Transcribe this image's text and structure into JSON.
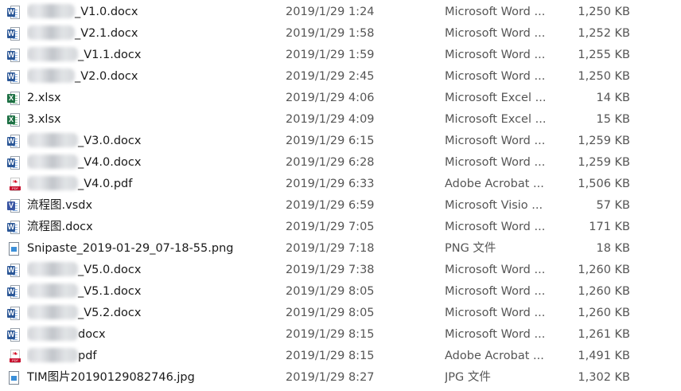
{
  "files": [
    {
      "name": "_V1.0.docx",
      "blur_width": 60,
      "date": "2019/1/29 1:24",
      "type": "Microsoft Word ...",
      "size": "1,250 KB",
      "icon": "word-icon"
    },
    {
      "name": "_V2.1.docx",
      "blur_width": 60,
      "date": "2019/1/29 1:58",
      "type": "Microsoft Word ...",
      "size": "1,252 KB",
      "icon": "word-icon"
    },
    {
      "name": "_V1.1.docx",
      "blur_width": 64,
      "date": "2019/1/29 1:59",
      "type": "Microsoft Word ...",
      "size": "1,255 KB",
      "icon": "word-icon"
    },
    {
      "name": "_V2.0.docx",
      "blur_width": 60,
      "date": "2019/1/29 2:45",
      "type": "Microsoft Word ...",
      "size": "1,250 KB",
      "icon": "word-icon"
    },
    {
      "name": "2.xlsx",
      "blur_width": 0,
      "date": "2019/1/29 4:06",
      "type": "Microsoft Excel ...",
      "size": "14 KB",
      "icon": "excel-icon"
    },
    {
      "name": "3.xlsx",
      "blur_width": 0,
      "date": "2019/1/29 4:09",
      "type": "Microsoft Excel ...",
      "size": "15 KB",
      "icon": "excel-icon"
    },
    {
      "name": "_V3.0.docx",
      "blur_width": 64,
      "date": "2019/1/29 6:15",
      "type": "Microsoft Word ...",
      "size": "1,259 KB",
      "icon": "word-icon"
    },
    {
      "name": "_V4.0.docx",
      "blur_width": 64,
      "date": "2019/1/29 6:28",
      "type": "Microsoft Word ...",
      "size": "1,259 KB",
      "icon": "word-icon"
    },
    {
      "name": "_V4.0.pdf",
      "blur_width": 64,
      "date": "2019/1/29 6:33",
      "type": "Adobe Acrobat ...",
      "size": "1,506 KB",
      "icon": "pdf-icon"
    },
    {
      "name": "流程图.vsdx",
      "blur_width": 0,
      "date": "2019/1/29 6:59",
      "type": "Microsoft Visio ...",
      "size": "57 KB",
      "icon": "visio-icon"
    },
    {
      "name": "流程图.docx",
      "blur_width": 0,
      "date": "2019/1/29 7:05",
      "type": "Microsoft Word ...",
      "size": "171 KB",
      "icon": "word-icon"
    },
    {
      "name": "Snipaste_2019-01-29_07-18-55.png",
      "blur_width": 0,
      "date": "2019/1/29 7:18",
      "type": "PNG 文件",
      "size": "18 KB",
      "icon": "image-icon"
    },
    {
      "name": "_V5.0.docx",
      "blur_width": 64,
      "date": "2019/1/29 7:38",
      "type": "Microsoft Word ...",
      "size": "1,260 KB",
      "icon": "word-icon"
    },
    {
      "name": "_V5.1.docx",
      "blur_width": 64,
      "date": "2019/1/29 8:05",
      "type": "Microsoft Word ...",
      "size": "1,260 KB",
      "icon": "word-icon"
    },
    {
      "name": "_V5.2.docx",
      "blur_width": 64,
      "date": "2019/1/29 8:05",
      "type": "Microsoft Word ...",
      "size": "1,260 KB",
      "icon": "word-icon"
    },
    {
      "name": "docx",
      "blur_width": 64,
      "date": "2019/1/29 8:15",
      "type": "Microsoft Word ...",
      "size": "1,261 KB",
      "icon": "word-icon"
    },
    {
      "name": "pdf",
      "blur_width": 64,
      "date": "2019/1/29 8:15",
      "type": "Adobe Acrobat ...",
      "size": "1,491 KB",
      "icon": "pdf-icon"
    },
    {
      "name": "TIM图片20190129082746.jpg",
      "blur_width": 0,
      "date": "2019/1/29 8:27",
      "type": "JPG 文件",
      "size": "1,302 KB",
      "icon": "image-icon"
    }
  ]
}
